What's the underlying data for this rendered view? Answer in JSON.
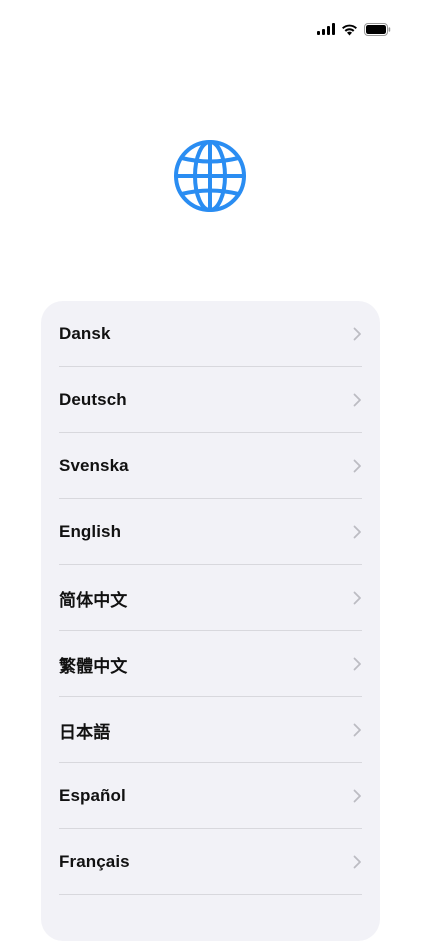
{
  "status_bar": {
    "icons": [
      "cellular-signal-icon",
      "wifi-icon",
      "battery-icon"
    ]
  },
  "header": {
    "icon": "globe-icon",
    "icon_color": "#2a8df2"
  },
  "languages": [
    {
      "label": "Dansk"
    },
    {
      "label": "Deutsch"
    },
    {
      "label": "Svenska"
    },
    {
      "label": "English"
    },
    {
      "label": "简体中文"
    },
    {
      "label": "繁體中文"
    },
    {
      "label": "日本語"
    },
    {
      "label": "Español"
    },
    {
      "label": "Français"
    },
    {
      "label": ""
    }
  ]
}
